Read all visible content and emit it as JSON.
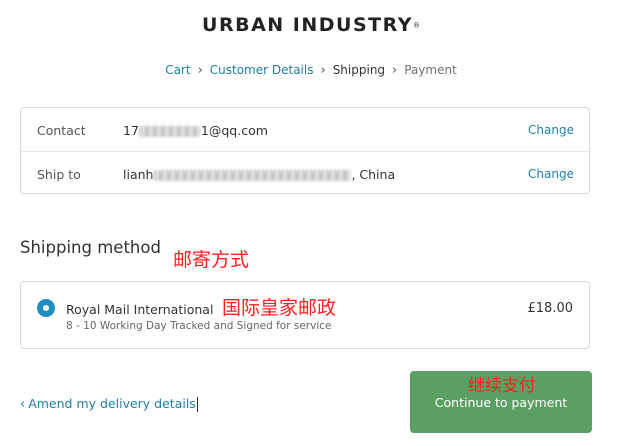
{
  "brand": {
    "name": "URBAN INDUSTRY",
    "mark": "®"
  },
  "breadcrumb": {
    "items": [
      {
        "label": "Cart"
      },
      {
        "label": "Customer Details"
      },
      {
        "label": "Shipping"
      },
      {
        "label": "Payment"
      }
    ],
    "separator": "›"
  },
  "review": {
    "contact": {
      "label": "Contact",
      "value_prefix": "17",
      "value_suffix": "1@qq.com",
      "change": "Change"
    },
    "ship_to": {
      "label": "Ship to",
      "value_prefix": "lianh",
      "value_suffix": ", China",
      "change": "Change"
    }
  },
  "shipping": {
    "title": "Shipping method",
    "option": {
      "name": "Royal Mail International",
      "description": "8 - 10 Working Day Tracked and Signed for service",
      "price": "£18.00",
      "selected": true
    }
  },
  "annotations": {
    "shipping_method": "邮寄方式",
    "royal_mail": "国际皇家邮政",
    "continue": "继续支付",
    "color": "#ff2020"
  },
  "footer": {
    "back_link": "Amend my delivery details",
    "back_icon": "chevron-left-icon",
    "continue_button": "Continue to payment"
  },
  "colors": {
    "link": "#1f7fa6",
    "radio": "#1f8fc2",
    "button": "#5aa062"
  }
}
